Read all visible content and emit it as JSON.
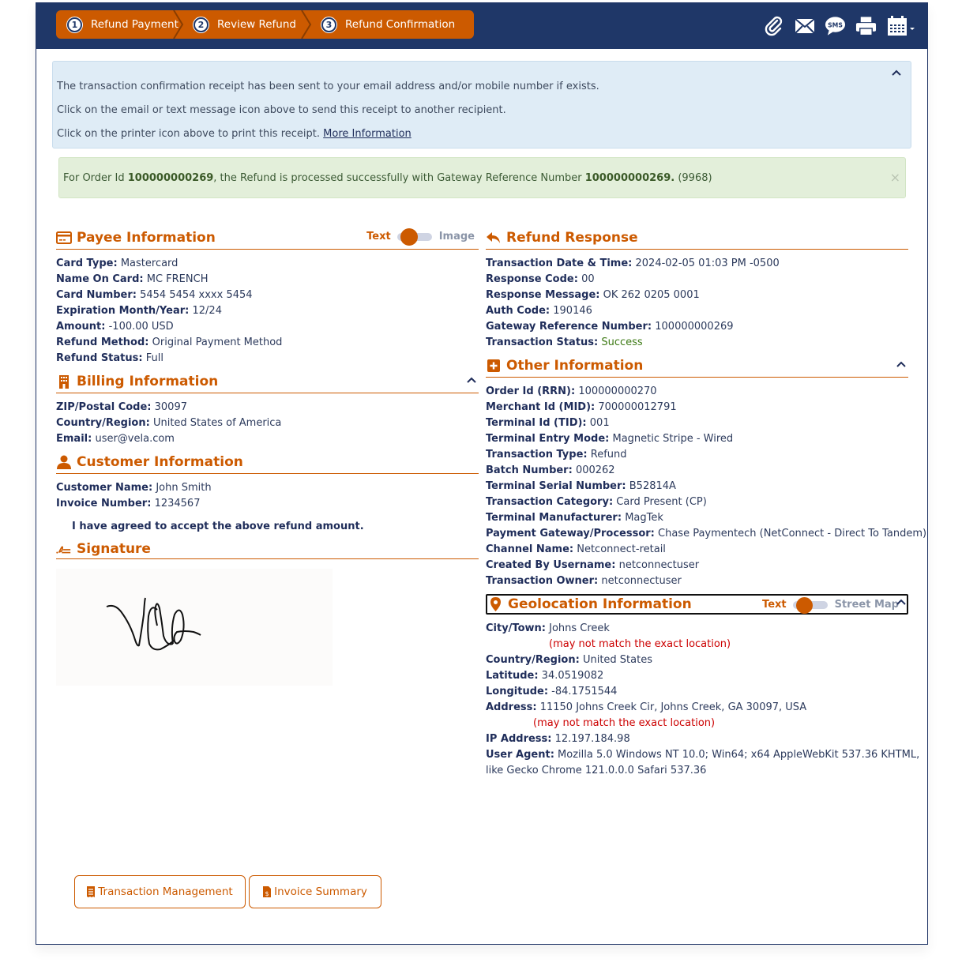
{
  "steps": [
    {
      "number": "1",
      "label": "Refund Payment"
    },
    {
      "number": "2",
      "label": "Review Refund"
    },
    {
      "number": "3",
      "label": "Refund Confirmation"
    }
  ],
  "toolbar_icons": [
    "paperclip-icon",
    "envelope-icon",
    "sms-icon",
    "printer-icon",
    "calendar-icon"
  ],
  "toolbar": {
    "sms_text": "SMS"
  },
  "info": {
    "line1": "The transaction confirmation receipt has been sent to your email address and/or mobile number if exists.",
    "line2": "Click on the email or text message icon above to send this receipt to another recipient.",
    "line3": "Click on the printer icon above to print this receipt.",
    "more_link": "More Information"
  },
  "success": {
    "prefix": "For Order Id ",
    "order_id": "100000000269",
    "middle": ", the Refund is processed successfully with Gateway Reference Number ",
    "gateway_ref": "100000000269.",
    "suffix": " (9968)",
    "close": "×"
  },
  "payee": {
    "title": "Payee Information",
    "toggle_on": "Text",
    "toggle_off": "Image",
    "rows": [
      {
        "label": "Card Type:",
        "value": "Mastercard"
      },
      {
        "label": "Name On Card:",
        "value": "MC FRENCH"
      },
      {
        "label": "Card Number:",
        "value": "5454 5454 xxxx 5454"
      },
      {
        "label": "Expiration Month/Year:",
        "value": "12/24"
      },
      {
        "label": "Amount:",
        "value": "-100.00 USD"
      },
      {
        "label": "Refund Method:",
        "value": "Original Payment Method"
      },
      {
        "label": "Refund Status:",
        "value": "Full"
      }
    ]
  },
  "billing": {
    "title": "Billing Information",
    "rows": [
      {
        "label": "ZIP/Postal Code:",
        "value": "30097"
      },
      {
        "label": "Country/Region:",
        "value": "United States of America"
      },
      {
        "label": "Email:",
        "value": "user@vela.com"
      }
    ]
  },
  "customer": {
    "title": "Customer Information",
    "rows": [
      {
        "label": "Customer Name:",
        "value": "John Smith"
      },
      {
        "label": "Invoice Number:",
        "value": "1234567"
      }
    ],
    "agreement": "I have agreed to accept the above refund amount."
  },
  "signature": {
    "title": "Signature",
    "signed_text": "Vela"
  },
  "refund_response": {
    "title": "Refund Response",
    "rows": [
      {
        "label": "Transaction Date & Time:",
        "value": "2024-02-05 01:03 PM -0500"
      },
      {
        "label": "Response Code:",
        "value": "00"
      },
      {
        "label": "Response Message:",
        "value": "OK 262 0205 0001"
      },
      {
        "label": "Auth Code:",
        "value": "190146"
      },
      {
        "label": "Gateway Reference Number:",
        "value": "100000000269"
      },
      {
        "label": "Transaction Status:",
        "value": "Success"
      }
    ]
  },
  "other": {
    "title": "Other Information",
    "rows": [
      {
        "label": "Order Id (RRN):",
        "value": "100000000270"
      },
      {
        "label": "Merchant Id (MID):",
        "value": "700000012791"
      },
      {
        "label": "Terminal Id (TID):",
        "value": "001"
      },
      {
        "label": "Terminal Entry Mode:",
        "value": "Magnetic Stripe - Wired"
      },
      {
        "label": "Transaction Type:",
        "value": "Refund"
      },
      {
        "label": "Batch Number:",
        "value": "000262"
      },
      {
        "label": "Terminal Serial Number:",
        "value": "B52814A"
      },
      {
        "label": "Transaction Category:",
        "value": "Card Present (CP)"
      },
      {
        "label": "Terminal Manufacturer:",
        "value": "MagTek"
      },
      {
        "label": "Payment Gateway/Processor:",
        "value": "Chase Paymentech (NetConnect - Direct To Tandem)"
      },
      {
        "label": "Channel Name:",
        "value": "Netconnect-retail"
      },
      {
        "label": "Created By Username:",
        "value": "netconnectuser"
      },
      {
        "label": "Transaction Owner:",
        "value": "netconnectuser"
      }
    ]
  },
  "geo": {
    "title": "Geolocation Information",
    "toggle_on": "Text",
    "toggle_off": "Street Map",
    "city_label": "City/Town:",
    "city": "Johns Creek",
    "disclaimer": "(may not match the exact location)",
    "country_label": "Country/Region:",
    "country": "United States",
    "lat_label": "Latitude:",
    "lat": "34.0519082",
    "lon_label": "Longitude:",
    "lon": "-84.1751544",
    "address_label": "Address:",
    "address": "11150 Johns Creek Cir, Johns Creek, GA 30097, USA",
    "ip_label": "IP Address:",
    "ip": "12.197.184.98",
    "ua_label": "User Agent:",
    "ua_line1": "Mozilla 5.0 Windows NT 10.0; Win64; x64 AppleWebKit 537.36 KHTML,",
    "ua_line2": "like Gecko Chrome 121.0.0.0 Safari 537.36"
  },
  "buttons": {
    "transaction_management": "Transaction Management",
    "invoice_summary": "Invoice Summary"
  },
  "colors": {
    "primary": "#1f3768",
    "accent": "#cc5a00",
    "success": "#3d7a14",
    "warning": "#cc0000"
  }
}
